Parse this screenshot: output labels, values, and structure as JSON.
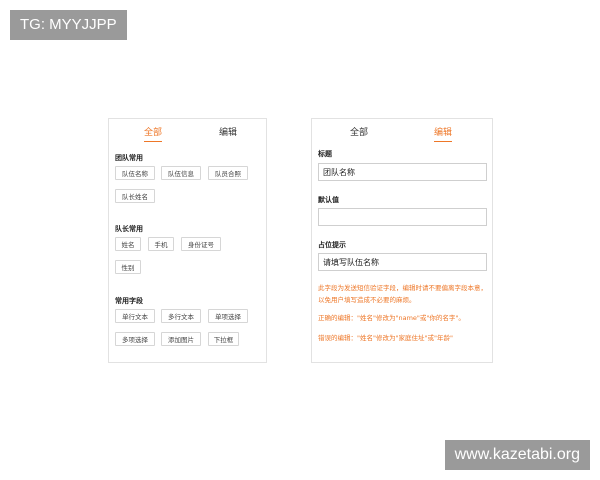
{
  "watermark": {
    "top_left": "TG: MYYJJPP",
    "bottom_right": "www.kazetabi.org"
  },
  "left_panel": {
    "tabs": [
      {
        "label": "全部",
        "active": true
      },
      {
        "label": "编辑",
        "active": false
      }
    ],
    "sections": [
      {
        "title": "团队常用",
        "chips": [
          "队伍名称",
          "队伍信息",
          "队员合照",
          "队长姓名"
        ]
      },
      {
        "title": "队长常用",
        "chips": [
          "姓名",
          "手机",
          "身份证号",
          "性别"
        ]
      },
      {
        "title": "常用字段",
        "chips": [
          "单行文本",
          "多行文本",
          "单项选择",
          "多项选择",
          "添加图片",
          "下拉框"
        ]
      }
    ]
  },
  "right_panel": {
    "tabs": [
      {
        "label": "全部",
        "active": false
      },
      {
        "label": "编辑",
        "active": true
      }
    ],
    "fields": [
      {
        "label": "标题",
        "value": "团队名称"
      },
      {
        "label": "默认值",
        "value": ""
      },
      {
        "label": "占位提示",
        "value": "请填写队伍名称"
      }
    ],
    "notes": [
      "此字段为发送短信验证字段，编辑时请不要偏离字段本意，以免用户填写造成不必要的麻烦。",
      "正确的编辑：\"姓名\"修改为\"name\"或\"你的名字\"。",
      "错误的编辑：\"姓名\"修改为\"家庭住址\"或\"年龄\""
    ]
  },
  "colors": {
    "accent": "#ee7728",
    "border": "#e2e2e2",
    "watermark_bg": "#9a9a9a"
  }
}
